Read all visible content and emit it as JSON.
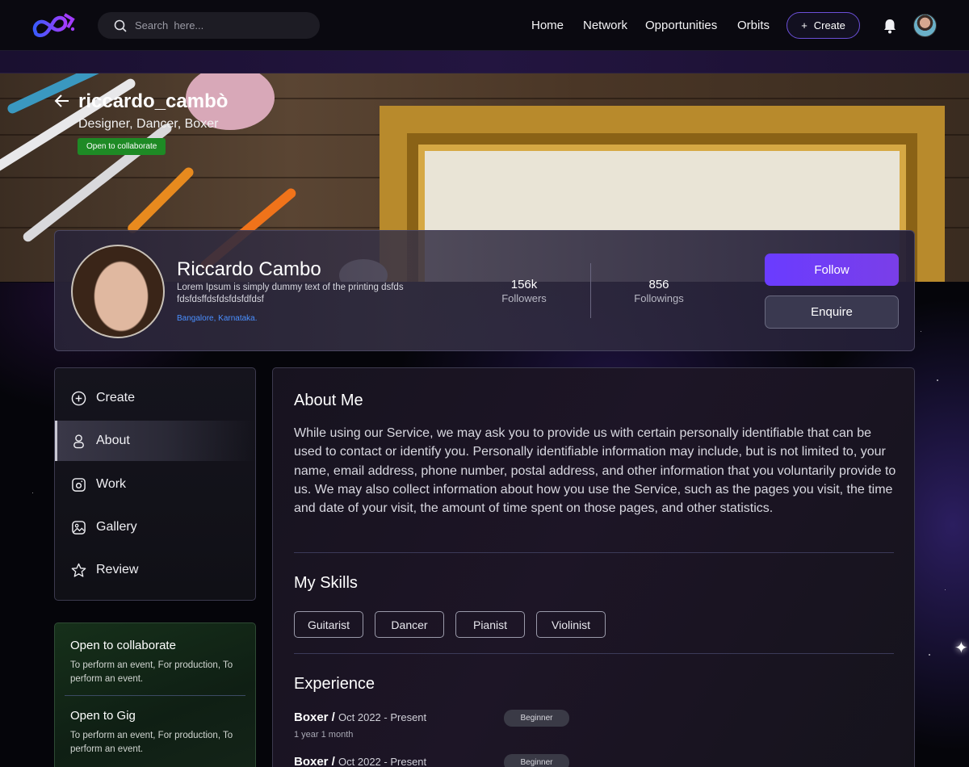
{
  "header": {
    "search_placeholder": "Search  here...",
    "nav": [
      "Home",
      "Network",
      "Opportunities",
      "Orbits"
    ],
    "create_label": "Create",
    "icons": [
      "logo-icon",
      "search-icon",
      "plus-icon",
      "bell-icon",
      "user-avatar"
    ]
  },
  "cover": {
    "username": "riccardo_cambò",
    "roles": "Designer, Dancer, Boxer",
    "badge": "Open to collaborate"
  },
  "profile": {
    "name": "Riccardo Cambo",
    "bio": "Lorem Ipsum is simply dummy text of the printing dsfds fdsfdsffdsfdsfdsfdfdsf",
    "location": "Bangalore, Karnataka.",
    "followers_count": "156k",
    "followers_label": "Followers",
    "followings_count": "856",
    "followings_label": "Followings",
    "follow_label": "Follow",
    "enquire_label": "Enquire"
  },
  "sidebar": {
    "items": [
      {
        "label": "Create",
        "icon": "plus-circle-icon"
      },
      {
        "label": "About",
        "icon": "user-icon",
        "active": true
      },
      {
        "label": "Work",
        "icon": "work-icon"
      },
      {
        "label": "Gallery",
        "icon": "image-icon"
      },
      {
        "label": "Review",
        "icon": "star-icon"
      }
    ]
  },
  "info_card": {
    "collab_title": "Open to collaborate",
    "collab_text": "To perform an event, For production, To perform an event.",
    "gig_title": "Open to Gig",
    "gig_text": "To perform an event, For production, To perform an event."
  },
  "main": {
    "about_title": "About Me",
    "about_text": "While using our Service, we may ask you to provide us with certain personally identifiable  that can be used to contact or identify you. Personally identifiable information may include, but is not limited to, your name, email address, phone number, postal address, and other information that you voluntarily provide to us. We may also collect information about how you use the Service, such as the pages you visit, the time and date of your visit, the amount of time spent on those pages, and other statistics.",
    "skills_title": "My Skills",
    "skills": [
      "Guitarist",
      "Dancer",
      "Pianist",
      "Violinist"
    ],
    "experience_title": "Experience",
    "experience": [
      {
        "role": "Boxer /",
        "date": "Oct 2022 - Present",
        "duration": "1 year 1 month",
        "level": "Beginner"
      },
      {
        "role": "Boxer /",
        "date": "Oct 2022 - Present",
        "level": "Beginner"
      }
    ]
  },
  "colors": {
    "accent": "#6a3cff",
    "badge_green": "#1e8a25",
    "location_blue": "#4a8fff",
    "background": "#07060c"
  }
}
